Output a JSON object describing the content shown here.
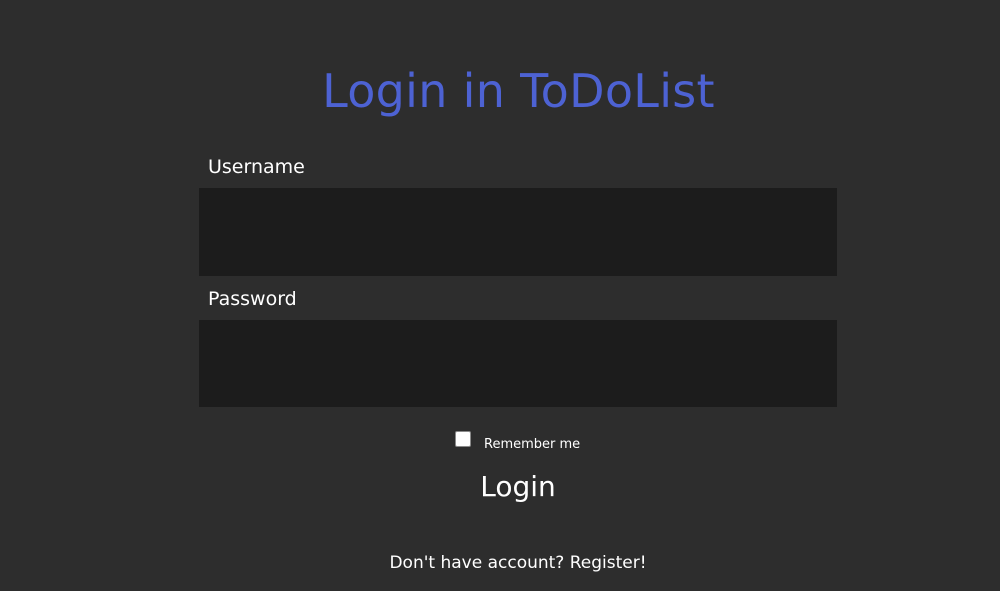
{
  "title": "Login in ToDoList",
  "form": {
    "username": {
      "label": "Username",
      "value": "",
      "placeholder": ""
    },
    "password": {
      "label": "Password",
      "value": "",
      "placeholder": ""
    },
    "remember": {
      "label": "Remember me",
      "checked": false
    },
    "login_label": "Login"
  },
  "register_link": "Don't have account? Register!",
  "colors": {
    "background": "#2d2d2d",
    "input_background": "#1c1c1c",
    "title": "#4d62d3",
    "text": "#ffffff"
  }
}
